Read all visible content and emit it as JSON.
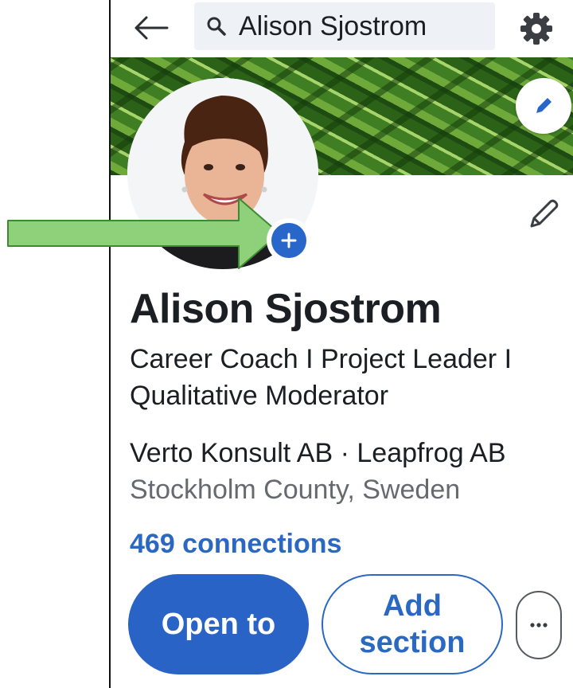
{
  "search": {
    "query": "Alison Sjostrom"
  },
  "profile": {
    "name": "Alison Sjostrom",
    "headline": "Career Coach I Project Leader I Qualitative Moderator",
    "company": "Verto Konsult AB · Leapfrog AB",
    "location": "Stockholm County, Sweden",
    "connections": "469 connections"
  },
  "actions": {
    "open_to_label": "Open to",
    "add_section_label": "Add section"
  },
  "icons": {
    "back": "arrow-left-icon",
    "search": "search-icon",
    "settings": "gear-icon",
    "edit_banner": "pencil-icon",
    "edit_intro": "pencil-icon",
    "add_photo": "plus-icon",
    "more": "ellipsis-icon",
    "annotation": "green-arrow-icon"
  },
  "colors": {
    "primary": "#2a63c6",
    "link": "#2b68c2",
    "muted_text": "#666a6f",
    "annotation_arrow": "#8fd17a"
  }
}
